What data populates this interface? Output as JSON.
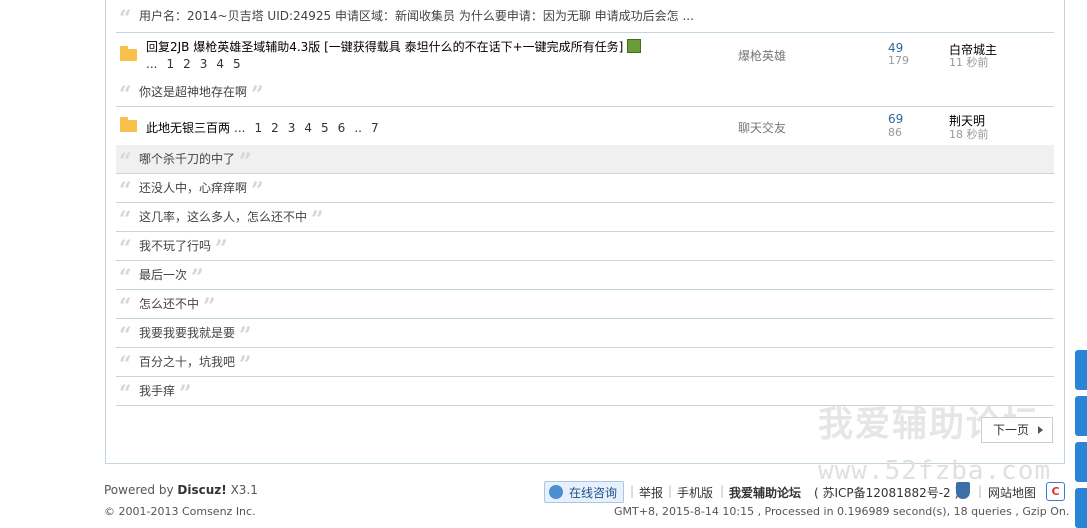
{
  "threads": {
    "top_quote": "用户名：2014~贝吉塔 UID:24925 申请区域：新闻收集员 为什么要申请：因为无聊 申请成功后会怎 ...",
    "thread1": {
      "title": "回复2JB 爆枪英雄圣域辅助4.3版 [一键获得载具 泰坦什么的不在话下+一键完成所有任务]",
      "pages": [
        "...",
        "1",
        "2",
        "3",
        "4",
        "5"
      ],
      "forum": "爆枪英雄",
      "replies": "49",
      "views": "179",
      "author": "白帝城主",
      "time": "11 秒前",
      "quote": "你这是超神地存在啊"
    },
    "thread2": {
      "title": "此地无银三百两",
      "pages": [
        "...",
        "1",
        "2",
        "3",
        "4",
        "5",
        "6",
        "..",
        "7"
      ],
      "forum": "聊天交友",
      "replies": "69",
      "views": "86",
      "author": "荆天明",
      "time": "18 秒前",
      "quotes": [
        "哪个杀千刀的中了",
        "还没人中，心痒痒啊",
        "这几率，这么多人，怎么还不中",
        "我不玩了行吗",
        "最后一次",
        "怎么还不中",
        "我要我要我就是要",
        "百分之十，坑我吧",
        "我手痒"
      ]
    }
  },
  "pagination": {
    "next_label": "下一页"
  },
  "watermark": {
    "line1": "我爱辅助论坛",
    "line2": "www.52fzba.com"
  },
  "footer": {
    "powered_prefix": "Powered by",
    "powered_brand": "Discuz!",
    "powered_version": "X3.1",
    "copyright": "© 2001-2013 Comsenz Inc.",
    "consult_label": "在线咨询",
    "report_label": "举报",
    "mobile_label": "手机版",
    "site_name": "我爱辅助论坛",
    "icp": "( 苏ICP备12081882号-2 )",
    "sitemap_label": "网站地图",
    "timeline": "GMT+8, 2015-8-14 10:15 , Processed in 0.196989 second(s), 18 queries , Gzip On."
  },
  "colors": {
    "separator": "#c2d5e3",
    "reply_count": "#336699",
    "side_button": "#2b85d6"
  }
}
